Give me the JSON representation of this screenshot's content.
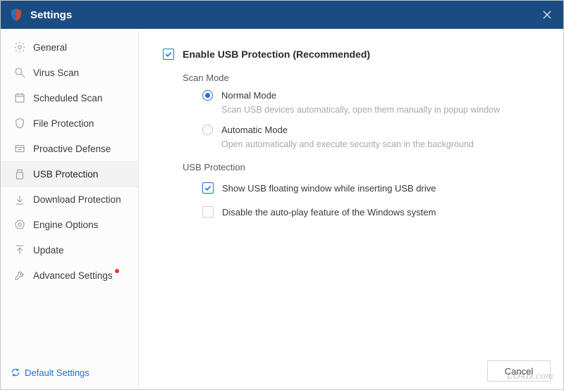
{
  "window": {
    "title": "Settings"
  },
  "sidebar": {
    "items": [
      {
        "label": "General"
      },
      {
        "label": "Virus Scan"
      },
      {
        "label": "Scheduled Scan"
      },
      {
        "label": "File Protection"
      },
      {
        "label": "Proactive Defense"
      },
      {
        "label": "USB Protection"
      },
      {
        "label": "Download Protection"
      },
      {
        "label": "Engine Options"
      },
      {
        "label": "Update"
      },
      {
        "label": "Advanced Settings"
      }
    ],
    "default_link": "Default Settings"
  },
  "content": {
    "enable_label": "Enable USB Protection (Recommended)",
    "scan_mode_label": "Scan Mode",
    "normal_mode_label": "Normal Mode",
    "normal_mode_desc": "Scan USB devices automatically, open them manually in popup window",
    "automatic_mode_label": "Automatic Mode",
    "automatic_mode_desc": "Open automatically and execute security scan in the background",
    "usb_protection_label": "USB Protection",
    "show_floating_label": "Show USB floating window while inserting USB drive",
    "disable_autoplay_label": "Disable the auto-play feature of the Windows system"
  },
  "buttons": {
    "cancel": "Cancel"
  },
  "watermark": "LO4D.com"
}
